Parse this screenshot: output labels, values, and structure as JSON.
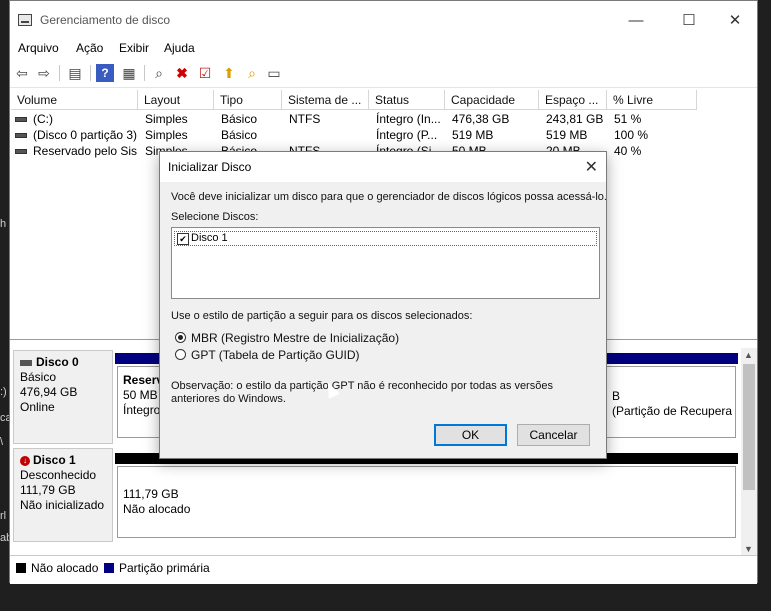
{
  "window": {
    "title": "Gerenciamento de disco",
    "controls": {
      "minimize": "—",
      "maximize": "☐",
      "close": "✕"
    }
  },
  "menu": [
    "Arquivo",
    "Ação",
    "Exibir",
    "Ajuda"
  ],
  "volume_list": {
    "columns": [
      "Volume",
      "Layout",
      "Tipo",
      "Sistema de ...",
      "Status",
      "Capacidade",
      "Espaço ...",
      "% Livre"
    ],
    "rows": [
      [
        "(C:)",
        "Simples",
        "Básico",
        "NTFS",
        "Íntegro (In...",
        "476,38 GB",
        "243,81 GB",
        "51 %"
      ],
      [
        "(Disco 0 partição 3)",
        "Simples",
        "Básico",
        "",
        "Íntegro (P...",
        "519 MB",
        "519 MB",
        "100 %"
      ],
      [
        "Reservado pelo Sis...",
        "Simples",
        "Básico",
        "NTFS",
        "Íntegro (Si...",
        "50 MB",
        "20 MB",
        "40 %"
      ]
    ]
  },
  "graph": {
    "disk0": {
      "name": "Disco 0",
      "type": "Básico",
      "size": "476,94 GB",
      "status": "Online",
      "partition_left": {
        "name": "Reserv",
        "size": "50 MB",
        "status": "Íntegro"
      },
      "partition_right": {
        "line1": "B",
        "line2": "(Partição de Recupera"
      }
    },
    "disk1": {
      "name": "Disco 1",
      "type": "Desconhecido",
      "size": "111,79 GB",
      "status": "Não inicializado",
      "unallocated": {
        "size": "111,79 GB",
        "label": "Não alocado"
      }
    }
  },
  "legend": [
    {
      "label": "Não alocado",
      "color": "#000000"
    },
    {
      "label": "Partição primária",
      "color": "#000080"
    }
  ],
  "dialog": {
    "title": "Inicializar Disco",
    "message": "Você deve inicializar um disco para que o gerenciador de discos lógicos possa acessá-lo.",
    "select_label": "Selecione Discos:",
    "disks": [
      "Disco 1"
    ],
    "partition_style_label": "Use o estilo de partição a seguir para os discos selecionados:",
    "option_mbr": "MBR (Registro Mestre de Inicialização)",
    "option_gpt": "GPT (Tabela de Partição GUID)",
    "note": "Observação: o estilo da partição GPT não é reconhecido por todas as versões anteriores do Windows.",
    "ok": "OK",
    "cancel": "Cancelar"
  },
  "background_fragments": [
    ":)",
    "ca",
    "\\",
    "rl",
    "ab",
    "h"
  ]
}
